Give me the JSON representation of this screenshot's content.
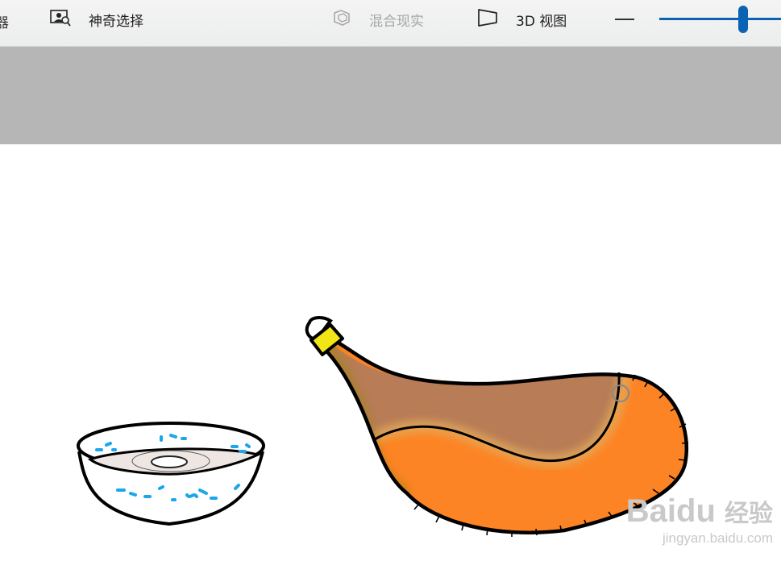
{
  "toolbar": {
    "edge_fragment": "器",
    "magic_select": {
      "label": "神奇选择",
      "icon": "magic-select-icon"
    },
    "mixed_reality": {
      "label": "混合现实",
      "icon": "mixed-reality-icon",
      "enabled": false
    },
    "view_3d": {
      "label": "3D 视图",
      "icon": "3d-view-icon"
    },
    "zoom": {
      "level": 0.65
    }
  },
  "drawing": {
    "subjects": [
      "bowl",
      "bottle"
    ],
    "colors": {
      "bottle_brown": "#b87c56",
      "bottle_orange": "#fd8424",
      "cap_yellow": "#f2e515",
      "bowl_blue": "#1aa7ea",
      "bowl_liquid": "#ede6e3",
      "outline": "#000000"
    }
  },
  "watermark": {
    "brand": "Baidu",
    "brand_cn": "经验",
    "url": "jingyan.baidu.com"
  }
}
